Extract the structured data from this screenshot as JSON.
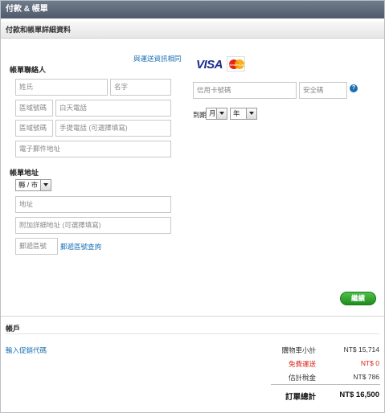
{
  "window": {
    "title": "付款 & 帳單"
  },
  "section": {
    "title": "付款和帳單詳細資料"
  },
  "contact": {
    "same_as_shipping_link": "與運送資訊相同",
    "heading": "帳單聯絡人",
    "last_name_placeholder": "姓氏",
    "first_name_placeholder": "名字",
    "area_code_placeholder_1": "區域號碼",
    "day_phone_placeholder": "白天電話",
    "area_code_placeholder_2": "區域號碼",
    "mobile_placeholder": "手提電話 (可選擇填寫)",
    "email_placeholder": "電子郵件地址"
  },
  "address": {
    "heading": "帳單地址",
    "county_select": "縣 / 市",
    "address_placeholder": "地址",
    "address_extra_placeholder": "附加詳細地址 (可選擇填寫)",
    "postal_placeholder": "郵遞區號",
    "postal_lookup_link": "郵遞區號查詢"
  },
  "card": {
    "brands": [
      "VISA",
      "MasterCard"
    ],
    "number_placeholder": "信用卡號碼",
    "cvv_placeholder": "安全碼",
    "help_icon": "?",
    "expiry_label": "到期",
    "month_select": "月",
    "year_select": "年"
  },
  "actions": {
    "continue_label": "繼續"
  },
  "account": {
    "heading": "帳戶",
    "promo_link": "輸入促銷代碼"
  },
  "summary": {
    "rows": [
      {
        "label": "購物車小計",
        "value": "NT$ 15,714",
        "highlight": false
      },
      {
        "label": "免費運送",
        "value": "NT$ 0",
        "highlight": true
      },
      {
        "label": "估計稅金",
        "value": "NT$ 786",
        "highlight": false
      }
    ],
    "total_label": "訂單總計",
    "total_value": "NT$ 16,500"
  },
  "colors": {
    "link": "#1a6fb3",
    "highlight": "#d9251c",
    "button": "#2a9a26",
    "title_bar": "#5b6778"
  }
}
